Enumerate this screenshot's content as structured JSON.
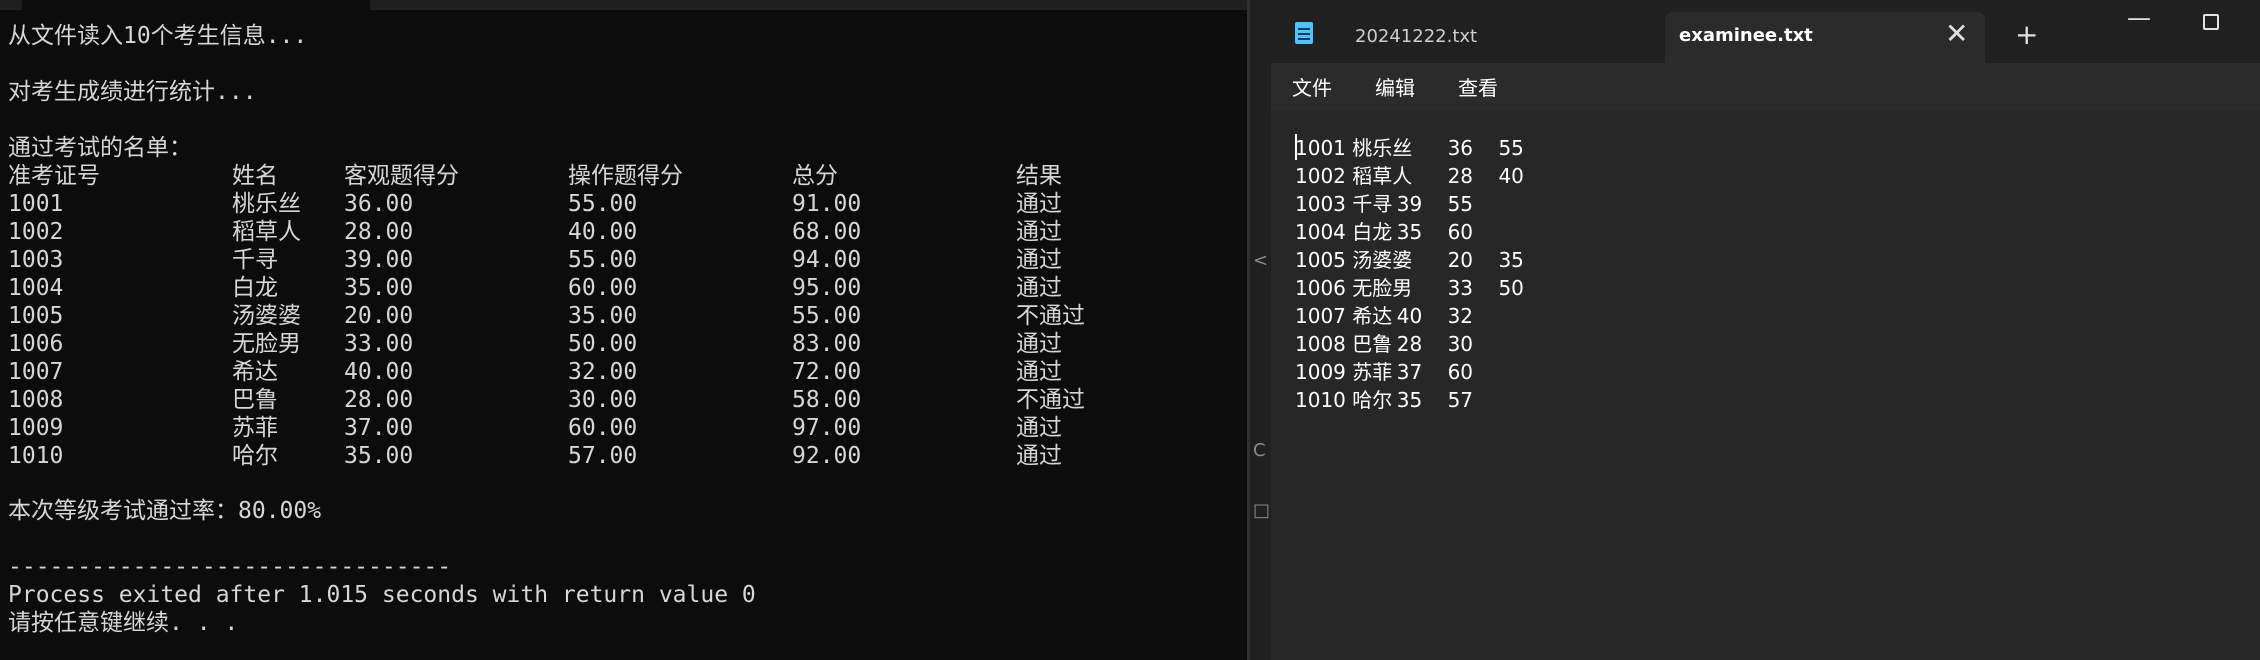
{
  "console": {
    "intro_line1": "从文件读入10个考生信息...",
    "intro_line2": "对考生成绩进行统计...",
    "pass_list_title": "通过考试的名单：",
    "headers": {
      "id": "准考证号",
      "name": "姓名",
      "obj": "客观题得分",
      "op": "操作题得分",
      "total": "总分",
      "result": "结果"
    },
    "rows": [
      {
        "id": "1001",
        "name": "桃乐丝",
        "obj": "36.00",
        "op": "55.00",
        "total": "91.00",
        "result": "通过"
      },
      {
        "id": "1002",
        "name": "稻草人",
        "obj": "28.00",
        "op": "40.00",
        "total": "68.00",
        "result": "通过"
      },
      {
        "id": "1003",
        "name": "千寻",
        "obj": "39.00",
        "op": "55.00",
        "total": "94.00",
        "result": "通过"
      },
      {
        "id": "1004",
        "name": "白龙",
        "obj": "35.00",
        "op": "60.00",
        "total": "95.00",
        "result": "通过"
      },
      {
        "id": "1005",
        "name": "汤婆婆",
        "obj": "20.00",
        "op": "35.00",
        "total": "55.00",
        "result": "不通过"
      },
      {
        "id": "1006",
        "name": "无脸男",
        "obj": "33.00",
        "op": "50.00",
        "total": "83.00",
        "result": "通过"
      },
      {
        "id": "1007",
        "name": "希达",
        "obj": "40.00",
        "op": "32.00",
        "total": "72.00",
        "result": "通过"
      },
      {
        "id": "1008",
        "name": "巴鲁",
        "obj": "28.00",
        "op": "30.00",
        "total": "58.00",
        "result": "不通过"
      },
      {
        "id": "1009",
        "name": "苏菲",
        "obj": "37.00",
        "op": "60.00",
        "total": "97.00",
        "result": "通过"
      },
      {
        "id": "1010",
        "name": "哈尔",
        "obj": "35.00",
        "op": "57.00",
        "total": "92.00",
        "result": "通过"
      }
    ],
    "pass_rate": "本次等级考试通过率：80.00%",
    "separator": "--------------------------------",
    "process_exit": "Process exited after 1.015 seconds with return value 0",
    "press_key": "请按任意键继续. . ."
  },
  "notepad": {
    "tab1_label": "20241222.txt",
    "tab2_label": "examinee.txt",
    "close_symbol": "✕",
    "newtab_symbol": "+",
    "minimize_symbol": "—",
    "menu": {
      "file": "文件",
      "edit": "编辑",
      "view": "查看"
    },
    "lines": [
      "1001 桃乐丝\t36\t55",
      "1002 稻草人\t28\t40",
      "1003 千寻\t39\t55",
      "1004 白龙\t35\t60",
      "1005 汤婆婆\t20\t35",
      "1006 无脸男\t33\t50",
      "1007 希达\t40\t32",
      "1008 巴鲁\t28\t30",
      "1009 苏菲\t37\t60",
      "1010 哈尔\t35\t57"
    ]
  },
  "gap": {
    "glyphs": [
      "<",
      "C",
      "□"
    ]
  },
  "colors": {
    "console_bg": "#0c0c0c",
    "console_text": "#d6d6d6",
    "notepad_bg": "#272727",
    "accent": "#4cc2ff"
  }
}
